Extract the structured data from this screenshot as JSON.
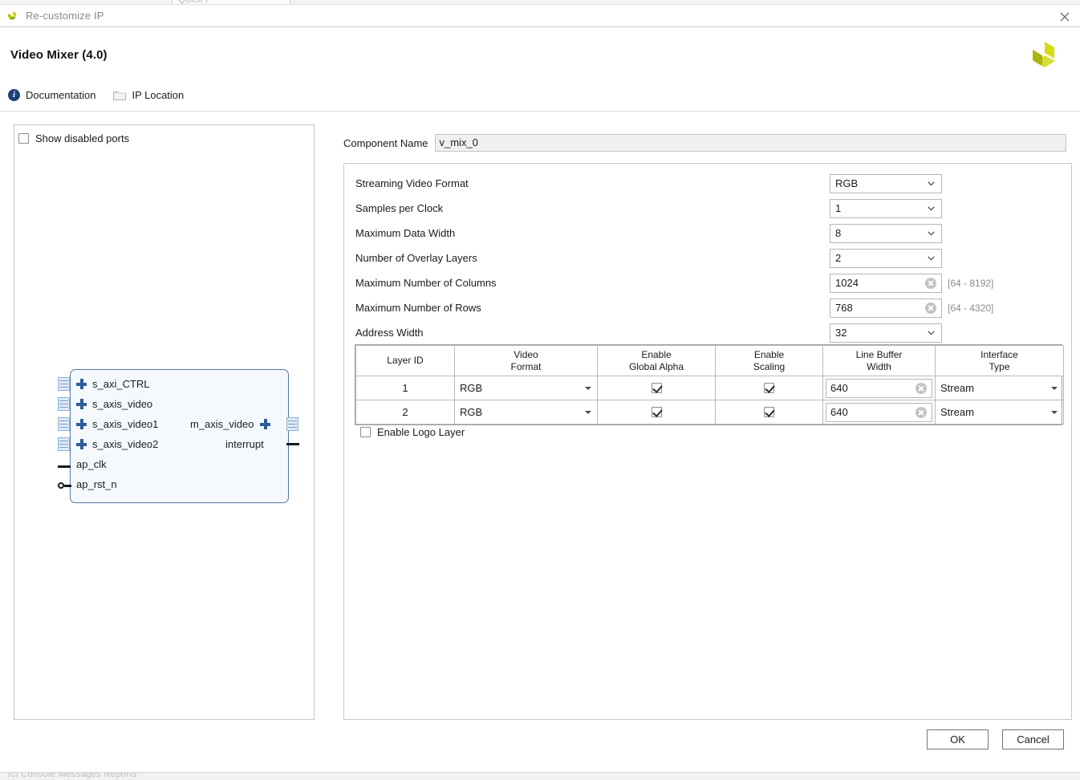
{
  "window": {
    "title": "Re-customize IP",
    "close_icon": "close-icon",
    "app_icon": "xilinx-logo-icon"
  },
  "header": {
    "title": "Video Mixer (4.0)",
    "brand_logo": "xilinx-brand-logo",
    "links": [
      {
        "label": "Documentation",
        "icon": "info-icon"
      },
      {
        "label": "IP Location",
        "icon": "folder-icon"
      }
    ]
  },
  "preview": {
    "show_disabled_ports": {
      "label": "Show disabled ports",
      "checked": false
    },
    "block": {
      "left_ports": [
        {
          "label": "s_axi_CTRL",
          "type": "bus"
        },
        {
          "label": "s_axis_video",
          "type": "bus"
        },
        {
          "label": "s_axis_video1",
          "type": "bus"
        },
        {
          "label": "s_axis_video2",
          "type": "bus"
        },
        {
          "label": "ap_clk",
          "type": "clock"
        },
        {
          "label": "ap_rst_n",
          "type": "reset"
        }
      ],
      "right_ports": [
        {
          "label": "m_axis_video",
          "type": "bus"
        },
        {
          "label": "interrupt",
          "type": "signal"
        }
      ]
    }
  },
  "component": {
    "label": "Component Name",
    "value": "v_mix_0"
  },
  "config": {
    "fields": [
      {
        "label": "Streaming Video Format",
        "kind": "select",
        "value": "RGB",
        "hint": ""
      },
      {
        "label": "Samples per Clock",
        "kind": "select",
        "value": "1",
        "hint": ""
      },
      {
        "label": "Maximum Data Width",
        "kind": "select",
        "value": "8",
        "hint": ""
      },
      {
        "label": "Number of Overlay Layers",
        "kind": "select",
        "value": "2",
        "hint": ""
      },
      {
        "label": "Maximum Number of Columns",
        "kind": "text",
        "value": "1024",
        "hint": "[64 - 8192]"
      },
      {
        "label": "Maximum Number of Rows",
        "kind": "text",
        "value": "768",
        "hint": "[64 - 4320]"
      },
      {
        "label": "Address Width",
        "kind": "select",
        "value": "32",
        "hint": ""
      }
    ]
  },
  "layer_table": {
    "headers": [
      {
        "line1": "Layer ID",
        "line2": ""
      },
      {
        "line1": "Video",
        "line2": "Format"
      },
      {
        "line1": "Enable",
        "line2": "Global Alpha"
      },
      {
        "line1": "Enable",
        "line2": "Scaling"
      },
      {
        "line1": "Line Buffer",
        "line2": "Width"
      },
      {
        "line1": "Interface",
        "line2": "Type"
      }
    ],
    "rows": [
      {
        "layer_id": "1",
        "video_format": "RGB",
        "global_alpha": true,
        "scaling": true,
        "line_buffer_width": "640",
        "interface_type": "Stream"
      },
      {
        "layer_id": "2",
        "video_format": "RGB",
        "global_alpha": true,
        "scaling": true,
        "line_buffer_width": "640",
        "interface_type": "Stream"
      }
    ]
  },
  "logo_layer": {
    "label": "Enable Logo Layer",
    "checked": false
  },
  "footer": {
    "ok_label": "OK",
    "cancel_label": "Cancel"
  },
  "colors": {
    "accent_blue": "#2b5d9b",
    "brand_yellow": "#c9d200",
    "panel_border": "#c8c8c8",
    "info_blue": "#1f3f77"
  }
}
